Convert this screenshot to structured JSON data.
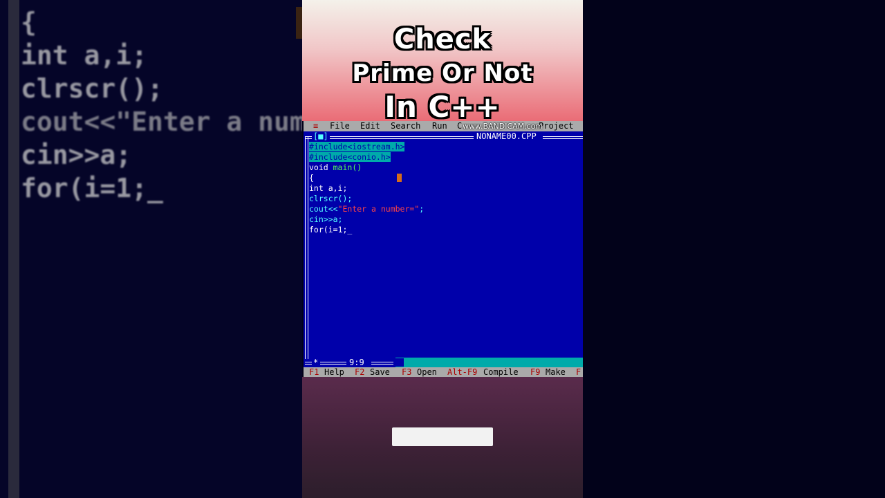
{
  "background_code": [
    "{",
    "int a,i;",
    "clrscr();",
    "cout<<\"Enter a num",
    "cin>>a;",
    "for(i=1;_"
  ],
  "headline": {
    "line1": "Check",
    "line2": "Prime Or Not",
    "line3": "In C++"
  },
  "watermark": "www.BANDICAM.com",
  "menu": {
    "system": "≡",
    "items": [
      "File",
      "Edit",
      "Search",
      "Run",
      "C",
      "Project"
    ]
  },
  "editor": {
    "close_box": "[■]",
    "filename": "NONAME00.CPP",
    "lines": [
      [
        {
          "t": "#include<iostream.h>",
          "c": "hl"
        }
      ],
      [
        {
          "t": "#include<conio.h>",
          "c": "hl"
        }
      ],
      [
        {
          "t": "void ",
          "c": "w"
        },
        {
          "t": "main()",
          "c": "g"
        }
      ],
      [
        {
          "t": "{",
          "c": "w"
        }
      ],
      [
        {
          "t": "int a,i;",
          "c": "w"
        }
      ],
      [
        {
          "t": "clrscr();",
          "c": "c"
        }
      ],
      [
        {
          "t": "cout<<",
          "c": "c"
        },
        {
          "t": "\"Enter a number=\"",
          "c": "r"
        },
        {
          "t": ";",
          "c": "c"
        }
      ],
      [
        {
          "t": "cin>>a;",
          "c": "c"
        }
      ],
      [
        {
          "t": "for(i=1;",
          "c": "w"
        },
        {
          "t": "_",
          "c": "w"
        }
      ]
    ],
    "cursor_position": "9:9",
    "star": "*"
  },
  "function_keys": [
    {
      "key": "F1",
      "label": "Help"
    },
    {
      "key": "F2",
      "label": "Save"
    },
    {
      "key": "F3",
      "label": "Open"
    },
    {
      "key": "Alt-F9",
      "label": "Compile"
    },
    {
      "key": "F9",
      "label": "Make"
    },
    {
      "key": "F",
      "label": ""
    }
  ],
  "colors": {
    "editor_bg": "#0000aa",
    "menu_bg": "#aaaaaa",
    "hotkey": "#aa0000",
    "highlight": "#00aaaa"
  }
}
